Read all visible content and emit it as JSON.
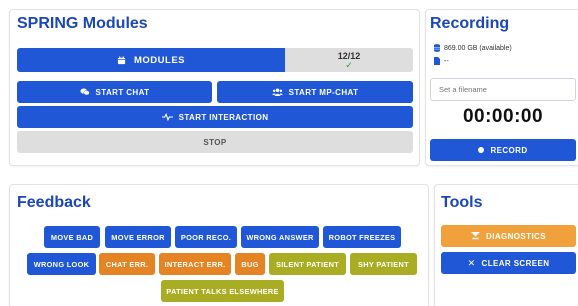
{
  "modules_card": {
    "title": "SPRING Modules",
    "modules_label": "MODULES",
    "progress": "12/12",
    "start_chat": "START CHAT",
    "start_mp_chat": "START MP-CHAT",
    "start_interaction": "START INTERACTION",
    "stop": "STOP"
  },
  "recording_card": {
    "title": "Recording",
    "storage": "869.00 GB (available)",
    "file_status": "--",
    "filename_placeholder": "Set a filename",
    "timer": "00:00:00",
    "record_label": "RECORD"
  },
  "feedback_card": {
    "title": "Feedback",
    "buttons": [
      {
        "label": "MOVE BAD",
        "color": "blue"
      },
      {
        "label": "MOVE ERROR",
        "color": "blue"
      },
      {
        "label": "POOR RECO.",
        "color": "blue"
      },
      {
        "label": "WRONG ANSWER",
        "color": "blue"
      },
      {
        "label": "ROBOT FREEZES",
        "color": "blue"
      },
      {
        "label": "WRONG LOOK",
        "color": "blue"
      },
      {
        "label": "CHAT ERR.",
        "color": "orange"
      },
      {
        "label": "INTERACT ERR.",
        "color": "orange"
      },
      {
        "label": "BUG",
        "color": "orange"
      },
      {
        "label": "SILENT PATIENT",
        "color": "olive"
      },
      {
        "label": "SHY PATIENT",
        "color": "olive"
      },
      {
        "label": "PATIENT TALKS ELSEWHERE",
        "color": "olive"
      }
    ]
  },
  "tools_card": {
    "title": "Tools",
    "diagnostics": "DIAGNOSTICS",
    "clear_screen": "CLEAR SCREEN"
  },
  "colors": {
    "primary": "#1f57d6",
    "title": "#1b47b8",
    "orange": "#e58424",
    "olive": "#a8ad23",
    "amber": "#f0a13c",
    "grey": "#dedede",
    "success": "#2e9e3a"
  },
  "icons": {
    "modules": "calendar-icon",
    "chat": "comments-icon",
    "mp_chat": "users-icon",
    "interaction": "pulse-icon",
    "storage": "database-icon",
    "file": "file-icon",
    "record": "record-dot-icon",
    "diagnostics": "stethoscope-icon",
    "clear": "close-icon"
  }
}
